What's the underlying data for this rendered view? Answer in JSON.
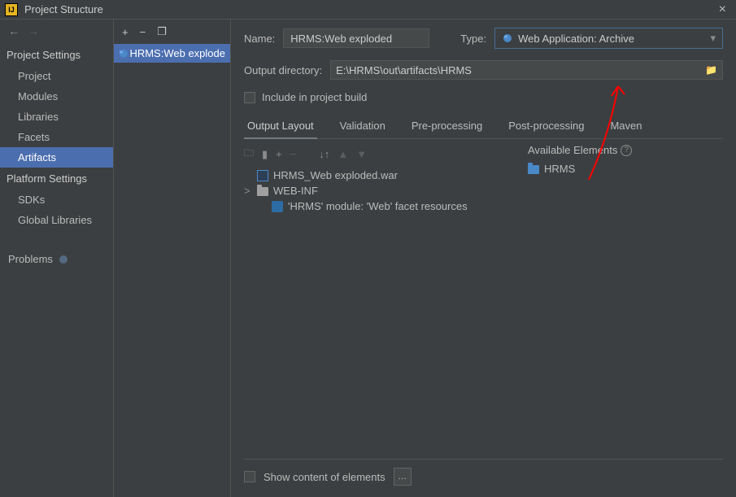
{
  "title": "Project Structure",
  "left_nav": {
    "sections": [
      {
        "label": "Project Settings",
        "items": [
          "Project",
          "Modules",
          "Libraries",
          "Facets",
          "Artifacts"
        ],
        "selected": 4
      },
      {
        "label": "Platform Settings",
        "items": [
          "SDKs",
          "Global Libraries"
        ],
        "selected": -1
      }
    ],
    "problems_label": "Problems"
  },
  "artifact_list": {
    "items": [
      {
        "label": "HRMS:Web explode"
      }
    ]
  },
  "form": {
    "name_label": "Name:",
    "name_value": "HRMS:Web exploded",
    "type_label": "Type:",
    "type_value": "Web Application: Archive",
    "outdir_label": "Output directory:",
    "outdir_value": "E:\\HRMS\\out\\artifacts\\HRMS",
    "include_label": "Include in project build"
  },
  "tabs": [
    "Output Layout",
    "Validation",
    "Pre-processing",
    "Post-processing",
    "Maven"
  ],
  "active_tab": 0,
  "tree": [
    {
      "depth": 0,
      "icon": "war",
      "label": "HRMS_Web exploded.war"
    },
    {
      "depth": 0,
      "caret": ">",
      "icon": "folder",
      "label": "WEB-INF"
    },
    {
      "depth": 1,
      "icon": "facet",
      "label": "'HRMS' module: 'Web' facet resources"
    }
  ],
  "available": {
    "header": "Available Elements",
    "items": [
      {
        "icon": "bluefolder",
        "label": "HRMS"
      }
    ]
  },
  "bottom": {
    "show_label": "Show content of elements",
    "more": "…"
  }
}
